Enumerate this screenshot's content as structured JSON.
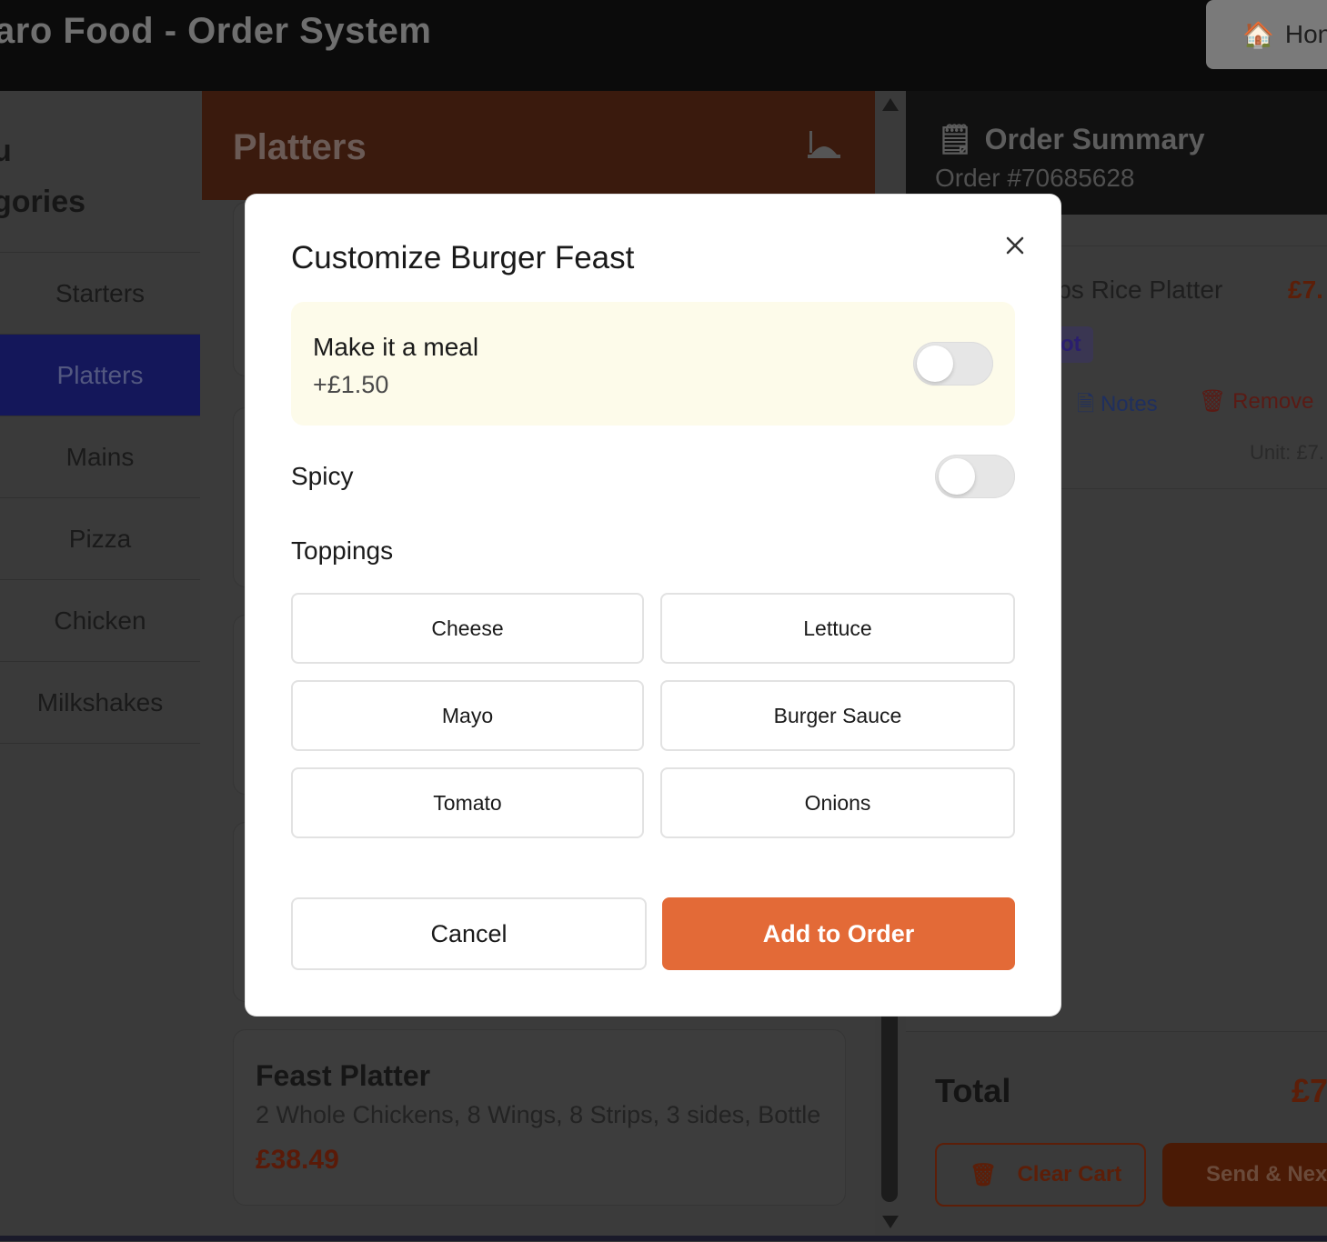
{
  "header": {
    "app_title": "aro Food - Order System",
    "home_label": "Hon",
    "home_icon": "home-icon"
  },
  "sidebar": {
    "heading_line1": "u",
    "heading_line2": "gories",
    "items": [
      {
        "label": "Starters",
        "active": false
      },
      {
        "label": "Platters",
        "active": true
      },
      {
        "label": "Mains",
        "active": false
      },
      {
        "label": "Pizza",
        "active": false
      },
      {
        "label": "Chicken",
        "active": false
      },
      {
        "label": "Milkshakes",
        "active": false
      }
    ]
  },
  "menu": {
    "section_title": "Platters",
    "cards": [
      {
        "name": "Feast Platter",
        "description": "2 Whole Chickens, 8 Wings, 8 Strips, 3 sides, Bottle",
        "price": "£38.49"
      }
    ]
  },
  "summary": {
    "title": "Order Summary",
    "order_number": "Order #70685628",
    "item": {
      "name": "ips Rice Platter",
      "price": "£7.",
      "tag": "ot",
      "notes_label": "Notes",
      "remove_label": "Remove",
      "unit": "Unit: £7."
    },
    "total_label": "Total",
    "total_value": "£7",
    "clear_label": "Clear Cart",
    "send_label": "Send & Nex"
  },
  "modal": {
    "title": "Customize Burger Feast",
    "meal_label": "Make it a meal",
    "meal_price": "+£1.50",
    "meal_on": false,
    "spicy_label": "Spicy",
    "spicy_on": false,
    "toppings_label": "Toppings",
    "toppings": [
      "Cheese",
      "Lettuce",
      "Mayo",
      "Burger Sauce",
      "Tomato",
      "Onions"
    ],
    "cancel_label": "Cancel",
    "add_label": "Add to Order"
  },
  "colors": {
    "accent": "#e36a37",
    "overlay": "rgba(0,0,0,0.75)"
  }
}
